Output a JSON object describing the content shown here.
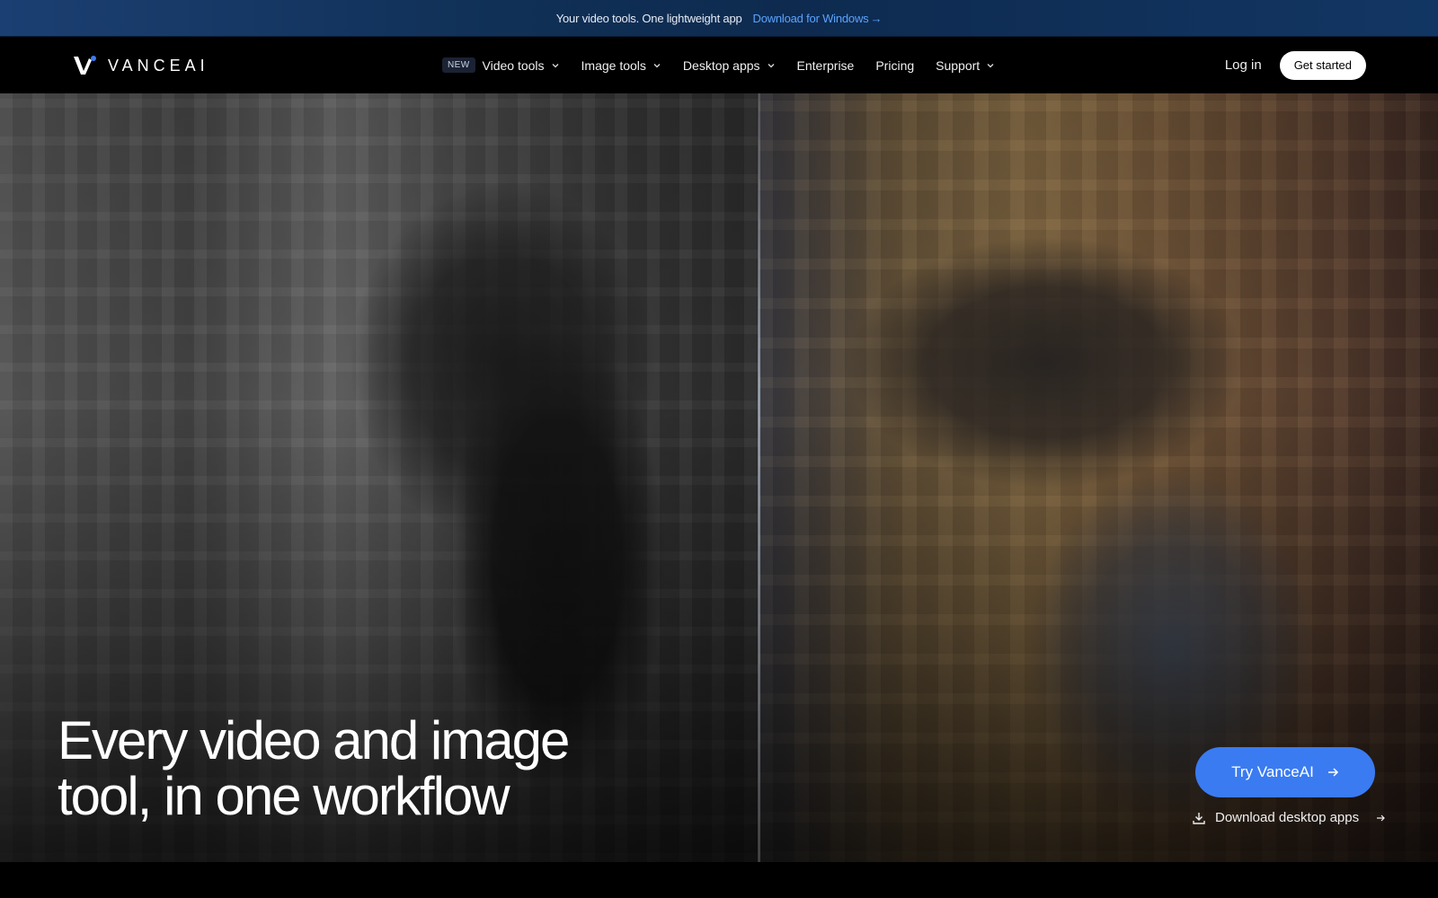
{
  "banner": {
    "text": "Your video tools. One lightweight app",
    "link": "Download for Windows"
  },
  "brand": {
    "name": "VANCEAI",
    "accent": "#3a7bf2"
  },
  "nav": {
    "badge": "NEW",
    "items": [
      {
        "label": "Video tools",
        "dropdown": true
      },
      {
        "label": "Image tools",
        "dropdown": true
      },
      {
        "label": "Desktop apps",
        "dropdown": true
      },
      {
        "label": "Enterprise",
        "dropdown": false
      },
      {
        "label": "Pricing",
        "dropdown": false
      },
      {
        "label": "Support",
        "dropdown": true
      }
    ],
    "login": "Log in",
    "cta": "Get started"
  },
  "hero": {
    "headline_line1": "Every video and image",
    "headline_line2": "tool, in one workflow",
    "primary_cta": "Try VanceAI",
    "secondary_cta": "Download desktop apps"
  },
  "icons": {
    "arrow": "arrow-right-icon",
    "chevron": "chevron-down-icon",
    "download": "download-icon"
  }
}
